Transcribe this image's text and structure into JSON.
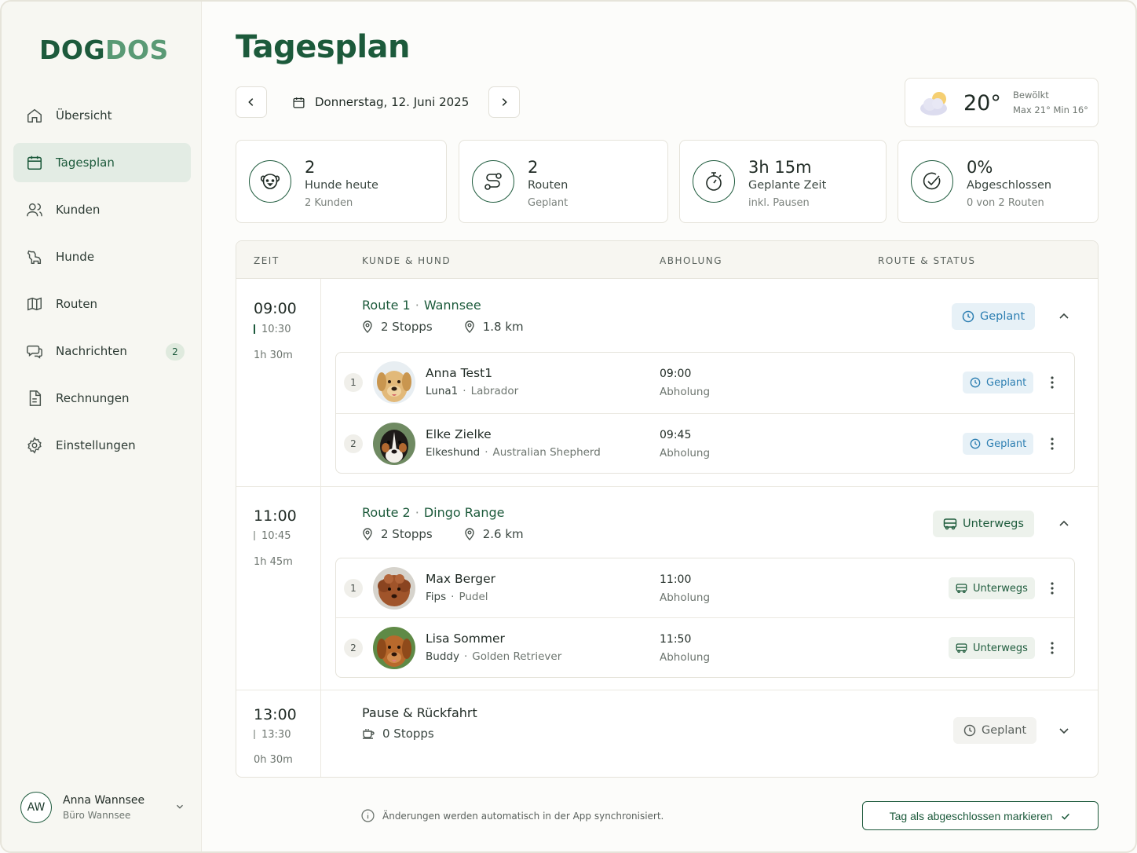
{
  "brand": {
    "part1": "DOG",
    "part2": "DOS"
  },
  "sidebar": {
    "items": [
      {
        "label": "Übersicht",
        "icon": "home-icon"
      },
      {
        "label": "Tagesplan",
        "icon": "calendar-icon",
        "active": true
      },
      {
        "label": "Kunden",
        "icon": "users-icon"
      },
      {
        "label": "Hunde",
        "icon": "dog-icon"
      },
      {
        "label": "Routen",
        "icon": "map-icon"
      },
      {
        "label": "Nachrichten",
        "icon": "chat-icon",
        "badge": "2"
      },
      {
        "label": "Rechnungen",
        "icon": "invoice-icon"
      },
      {
        "label": "Einstellungen",
        "icon": "gear-icon"
      }
    ],
    "user": {
      "initials": "AW",
      "name": "Anna Wannsee",
      "role": "Büro Wannsee"
    }
  },
  "header": {
    "title": "Tagesplan",
    "date": "Donnerstag, 12. Juni 2025"
  },
  "weather": {
    "temp": "20°",
    "desc": "Bewölkt",
    "minmax": "Max 21°  Min 16°",
    "icon": "cloud-sun-icon"
  },
  "stats": [
    {
      "value": "2",
      "label": "Hunde heute",
      "sub": "2 Kunden",
      "icon": "dog-face-icon"
    },
    {
      "value": "2",
      "label": "Routen",
      "sub": "Geplant",
      "icon": "route-icon"
    },
    {
      "value": "3h 15m",
      "label": "Geplante Zeit",
      "sub": "inkl. Pausen",
      "icon": "stopwatch-icon"
    },
    {
      "value": "0%",
      "label": "Abgeschlossen",
      "sub": "0 von 2 Routen",
      "icon": "check-circle-icon"
    }
  ],
  "table": {
    "headers": [
      "ZEIT",
      "KUNDE & HUND",
      "ABHOLUNG",
      "ROUTE & STATUS"
    ],
    "routes": [
      {
        "start": "09:00",
        "end": "10:30",
        "duration": "1h 30m",
        "name": "Route 1",
        "area": "Wannsee",
        "stops": "2 Stopps",
        "distance": "1.8 km",
        "status": "Geplant",
        "items": [
          {
            "num": "1",
            "customer": "Anna Test1",
            "dog": "Luna1",
            "breed": "Labrador",
            "time": "09:00",
            "type": "Abholung",
            "status": "Geplant"
          },
          {
            "num": "2",
            "customer": "Elke Zielke",
            "dog": "Elkeshund",
            "breed": "Australian Shepherd",
            "time": "09:45",
            "type": "Abholung",
            "status": "Geplant"
          }
        ]
      },
      {
        "start": "11:00",
        "end": "10:45",
        "duration": "1h 45m",
        "name": "Route 2",
        "area": "Dingo Range",
        "stops": "2 Stopps",
        "distance": "2.6 km",
        "status": "Unterwegs",
        "items": [
          {
            "num": "1",
            "customer": "Max Berger",
            "dog": "Fips",
            "breed": "Pudel",
            "time": "11:00",
            "type": "Abholung",
            "status": "Unterwegs"
          },
          {
            "num": "2",
            "customer": "Lisa Sommer",
            "dog": "Buddy",
            "breed": "Golden Retriever",
            "time": "11:50",
            "type": "Abholung",
            "status": "Unterwegs"
          }
        ]
      },
      {
        "start": "13:00",
        "end": "13:30",
        "duration": "0h 30m",
        "name": "Pause & Rückfahrt",
        "stops": "0 Stopps",
        "status": "Geplant"
      }
    ]
  },
  "footer": {
    "note": "Änderungen werden automatisch in der App synchronisiert.",
    "button": "Tag als abgeschlossen markieren"
  },
  "colors": {
    "brand_dark": "#1d5a3c",
    "brand_light": "#5a9a75",
    "planned_blue": "#2d7fb2",
    "active_bg": "#e3ece4"
  }
}
